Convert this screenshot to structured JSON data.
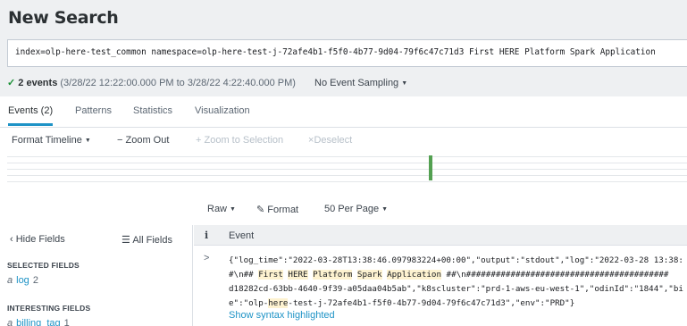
{
  "page": {
    "title": "New Search"
  },
  "search": {
    "query": "index=olp-here-test_common namespace=olp-here-test-j-72afe4b1-f5f0-4b77-9d04-79f6c47c71d3 First HERE Platform Spark Application"
  },
  "status": {
    "check": "✓",
    "count": "2 events",
    "range": " (3/28/22 12:22:00.000 PM to 3/28/22 4:22:40.000 PM)",
    "sampling": "No Event Sampling"
  },
  "tabs": [
    "Events (2)",
    "Patterns",
    "Statistics",
    "Visualization"
  ],
  "timeline": {
    "format": "Format Timeline",
    "zoom_out": "Zoom Out",
    "zoom_selection": "Zoom to Selection",
    "deselect": "Deselect"
  },
  "results": {
    "raw": "Raw",
    "format": "Format",
    "per_page": "50 Per Page"
  },
  "sidebar": {
    "hide": "Hide Fields",
    "all": "All Fields",
    "selected_title": "SELECTED FIELDS",
    "selected": [
      {
        "type": "a",
        "name": "log",
        "count": "2"
      }
    ],
    "interesting_title": "INTERESTING FIELDS",
    "interesting": [
      {
        "type": "a",
        "name": "billing_tag",
        "count": "1"
      }
    ]
  },
  "table": {
    "col_i": "i",
    "col_event": "Event",
    "event_lines": [
      "{\"log_time\":\"2022-03-28T13:38:46.097983224+00:00\",\"output\":\"stdout\",\"log\":\"2022-03-28 13:38:",
      [
        "#\\n## ",
        "First",
        " ",
        "HERE",
        " ",
        "Platform",
        " ",
        "Spark",
        " ",
        "Application",
        " ##\\n#########################################"
      ],
      "d18282cd-63bb-4640-9f39-a05daa04b5ab\",\"k8scluster\":\"prd-1-aws-eu-west-1\",\"odinId\":\"1844\",\"bi",
      [
        "e\":\"olp-",
        "here",
        "-test-j-72afe4b1-f5f0-4b77-9d04-79f6c47c71d3\",\"env\":\"PRD\"}"
      ]
    ],
    "syntax_link": "Show syntax highlighted"
  }
}
